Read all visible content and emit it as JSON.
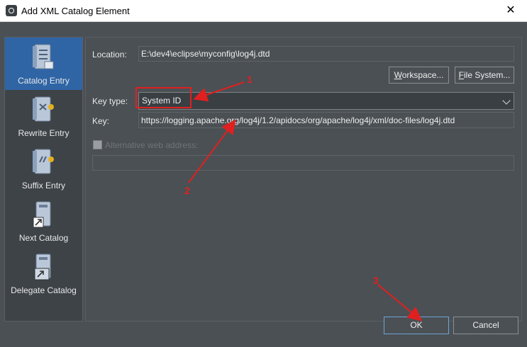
{
  "window": {
    "title": "Add XML Catalog Element",
    "close_glyph": "✕"
  },
  "sidebar": {
    "items": [
      {
        "label": "Catalog Entry",
        "icon": "catalog-entry-icon",
        "selected": true
      },
      {
        "label": "Rewrite Entry",
        "icon": "rewrite-entry-icon",
        "selected": false
      },
      {
        "label": "Suffix Entry",
        "icon": "suffix-entry-icon",
        "selected": false
      },
      {
        "label": "Next Catalog",
        "icon": "next-catalog-icon",
        "selected": false
      },
      {
        "label": "Delegate Catalog",
        "icon": "delegate-catalog-icon",
        "selected": false
      }
    ]
  },
  "form": {
    "location_label": "Location:",
    "location_value": "E:\\dev4\\eclipse\\myconfig\\log4j.dtd",
    "workspace_button": {
      "underlined": "W",
      "rest": "orkspace..."
    },
    "filesystem_button": {
      "underlined": "F",
      "rest": "ile System..."
    },
    "key_type_label": "Key type:",
    "key_type_value": "System ID",
    "key_label": "Key:",
    "key_value": "https://logging.apache.org/log4j/1.2/apidocs/org/apache/log4j/xml/doc-files/log4j.dtd",
    "alt_web_label": "Alternative web address:",
    "alt_web_checked": false,
    "alt_web_value": ""
  },
  "footer": {
    "ok_label": "OK",
    "cancel_label": "Cancel"
  },
  "annotations": {
    "num1": "1",
    "num2": "2",
    "num3": "3",
    "color": "#e02020"
  },
  "colors": {
    "dialog_bg": "#4b5054",
    "selected_bg": "#2f65a5",
    "accent_border": "#6fa3d8"
  }
}
